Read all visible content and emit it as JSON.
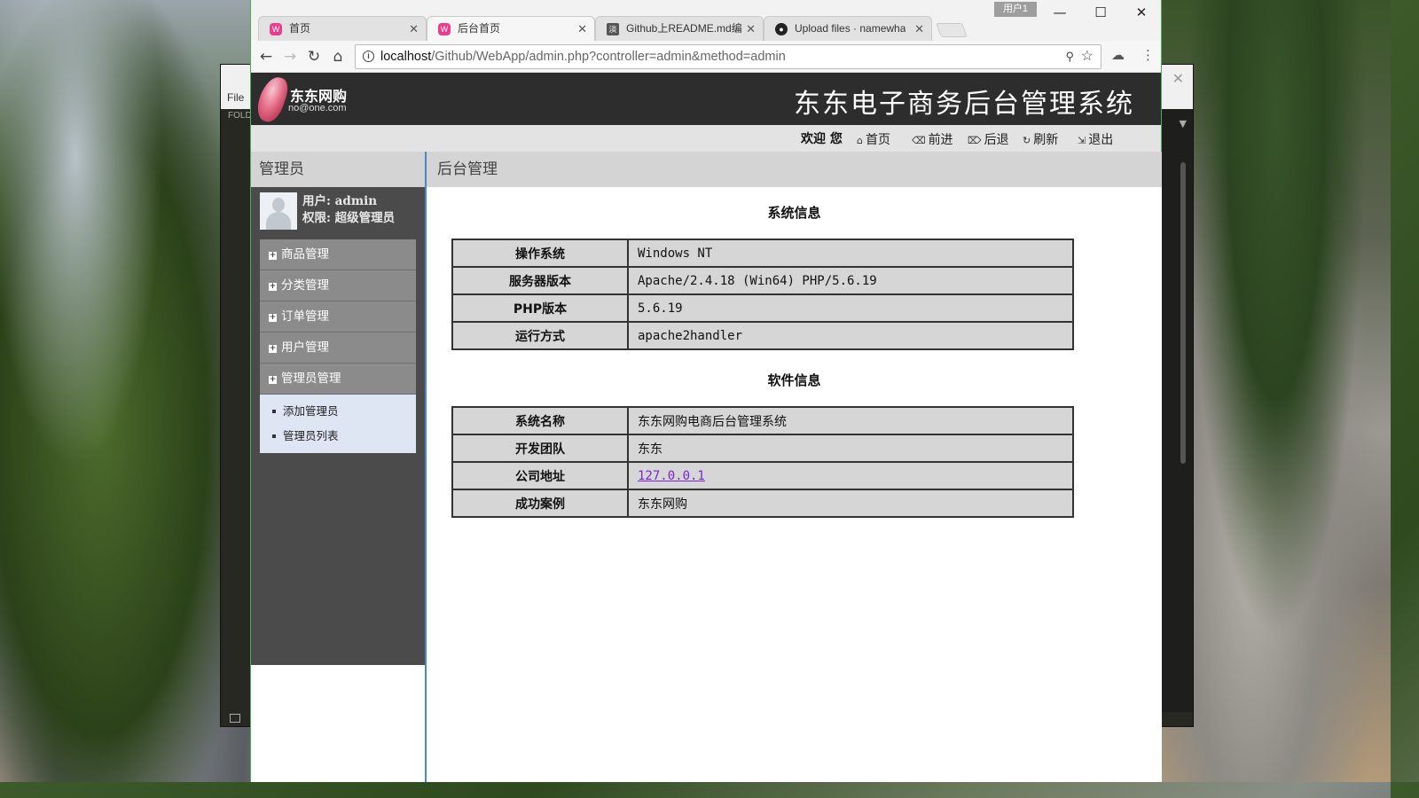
{
  "browser": {
    "tabs": [
      {
        "label": "首页",
        "icon": "w-icon"
      },
      {
        "label": "后台首页",
        "icon": "w-icon"
      },
      {
        "label": "Github上README.md编",
        "icon": "document-icon"
      },
      {
        "label": "Upload files · namewha",
        "icon": "github-icon"
      }
    ],
    "user_badge": "用户1",
    "url_host": "localhost",
    "url_path": "/Github/WebApp/admin.php?controller=admin&method=admin"
  },
  "editor": {
    "menu_file": "File",
    "folders_label": "FOLD"
  },
  "header": {
    "logo_name": "东东网购",
    "logo_email": "no@one.com",
    "system_title": "东东电子商务后台管理系统"
  },
  "actionbar": {
    "welcome": "欢迎 您",
    "home": "首页",
    "forward": "前进",
    "back": "后退",
    "refresh": "刷新",
    "logout": "退出"
  },
  "sidebar": {
    "title": "管理员",
    "user_line": "用户: admin",
    "role_line": "权限: 超级管理员",
    "items": [
      {
        "label": "商品管理"
      },
      {
        "label": "分类管理"
      },
      {
        "label": "订单管理"
      },
      {
        "label": "用户管理"
      },
      {
        "label": "管理员管理"
      }
    ],
    "subitems": [
      {
        "label": "添加管理员"
      },
      {
        "label": "管理员列表"
      }
    ]
  },
  "main": {
    "title": "后台管理",
    "system_section": "系统信息",
    "system_rows": [
      {
        "key": "操作系统",
        "value": "Windows NT"
      },
      {
        "key": "服务器版本",
        "value": "Apache/2.4.18 (Win64) PHP/5.6.19"
      },
      {
        "key": "PHP版本",
        "value": "5.6.19"
      },
      {
        "key": "运行方式",
        "value": "apache2handler"
      }
    ],
    "software_section": "软件信息",
    "software_rows": [
      {
        "key": "系统名称",
        "value": "东东网购电商后台管理系统"
      },
      {
        "key": "开发团队",
        "value": "东东"
      },
      {
        "key": "公司地址",
        "value": "127.0.0.1"
      },
      {
        "key": "成功案例",
        "value": "东东网购"
      }
    ]
  },
  "colors": {
    "header_bg": "#2d2d2d",
    "sidebar_bg": "#4b4b4b",
    "link": "#7b24d6",
    "accent_border": "#4a86c8"
  }
}
